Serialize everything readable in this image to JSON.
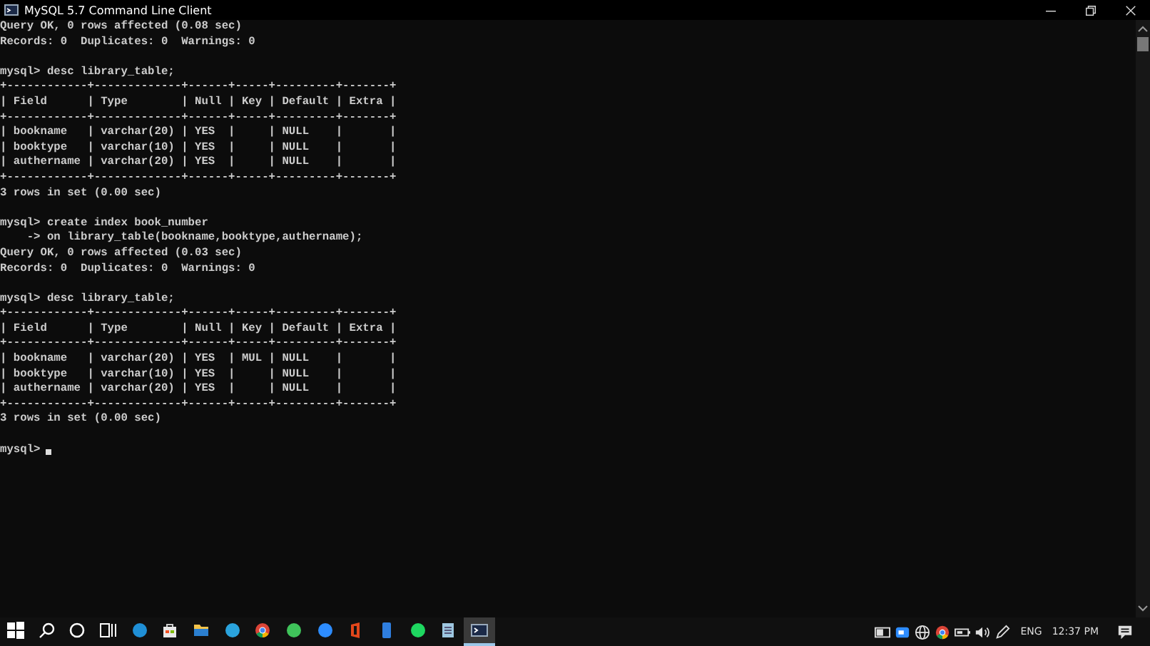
{
  "window": {
    "title": "MySQL 5.7 Command Line Client"
  },
  "console": {
    "lines": [
      {
        "kind": "text",
        "text": "Query OK, 0 rows affected (0.08 sec)"
      },
      {
        "kind": "text",
        "text": "Records: 0  Duplicates: 0  Warnings: 0"
      },
      {
        "kind": "blank"
      },
      {
        "kind": "text",
        "text": "mysql> desc library_table;"
      },
      {
        "kind": "text",
        "text": "+------------+-------------+------+-----+---------+-------+"
      },
      {
        "kind": "text",
        "text": "| Field      | Type        | Null | Key | Default | Extra |"
      },
      {
        "kind": "text",
        "text": "+------------+-------------+------+-----+---------+-------+"
      },
      {
        "kind": "text",
        "text": "| bookname   | varchar(20) | YES  |     | NULL    |       |"
      },
      {
        "kind": "text",
        "text": "| booktype   | varchar(10) | YES  |     | NULL    |       |"
      },
      {
        "kind": "text",
        "text": "| authername | varchar(20) | YES  |     | NULL    |       |"
      },
      {
        "kind": "text",
        "text": "+------------+-------------+------+-----+---------+-------+"
      },
      {
        "kind": "text",
        "text": "3 rows in set (0.00 sec)"
      },
      {
        "kind": "blank"
      },
      {
        "kind": "text",
        "text": "mysql> create index book_number"
      },
      {
        "kind": "text",
        "text": "    -> on library_table(bookname,booktype,authername);"
      },
      {
        "kind": "text",
        "text": "Query OK, 0 rows affected (0.03 sec)"
      },
      {
        "kind": "text",
        "text": "Records: 0  Duplicates: 0  Warnings: 0"
      },
      {
        "kind": "blank"
      },
      {
        "kind": "text",
        "text": "mysql> desc library_table;"
      },
      {
        "kind": "text",
        "text": "+------------+-------------+------+-----+---------+-------+"
      },
      {
        "kind": "text",
        "text": "| Field      | Type        | Null | Key | Default | Extra |"
      },
      {
        "kind": "text",
        "text": "+------------+-------------+------+-----+---------+-------+"
      },
      {
        "kind": "text",
        "text": "| bookname   | varchar(20) | YES  | MUL | NULL    |       |"
      },
      {
        "kind": "text",
        "text": "| booktype   | varchar(10) | YES  |     | NULL    |       |"
      },
      {
        "kind": "text",
        "text": "| authername | varchar(20) | YES  |     | NULL    |       |"
      },
      {
        "kind": "text",
        "text": "+------------+-------------+------+-----+---------+-------+"
      },
      {
        "kind": "text",
        "text": "3 rows in set (0.00 sec)"
      },
      {
        "kind": "blank"
      },
      {
        "kind": "prompt",
        "text": "mysql>"
      }
    ]
  },
  "taskbar": {
    "apps": [
      {
        "kind": "start",
        "selected": false
      },
      {
        "kind": "search",
        "selected": false
      },
      {
        "kind": "cortana",
        "selected": false
      },
      {
        "kind": "taskview",
        "selected": false
      },
      {
        "kind": "edge",
        "selected": false
      },
      {
        "kind": "store",
        "selected": false
      },
      {
        "kind": "folder",
        "selected": false
      },
      {
        "kind": "telegram",
        "selected": false
      },
      {
        "kind": "chrome",
        "selected": false
      },
      {
        "kind": "whatsapp",
        "selected": false
      },
      {
        "kind": "zoom",
        "selected": false
      },
      {
        "kind": "office",
        "selected": false
      },
      {
        "kind": "phone",
        "selected": false
      },
      {
        "kind": "spotify",
        "selected": false
      },
      {
        "kind": "notepad",
        "selected": false
      },
      {
        "kind": "console",
        "selected": true
      }
    ],
    "tray": [
      {
        "kind": "news"
      },
      {
        "kind": "zoom"
      },
      {
        "kind": "globe"
      },
      {
        "kind": "chrome"
      },
      {
        "kind": "battery"
      },
      {
        "kind": "volume"
      },
      {
        "kind": "pen"
      }
    ],
    "language": "ENG",
    "time": "12:37 PM"
  }
}
